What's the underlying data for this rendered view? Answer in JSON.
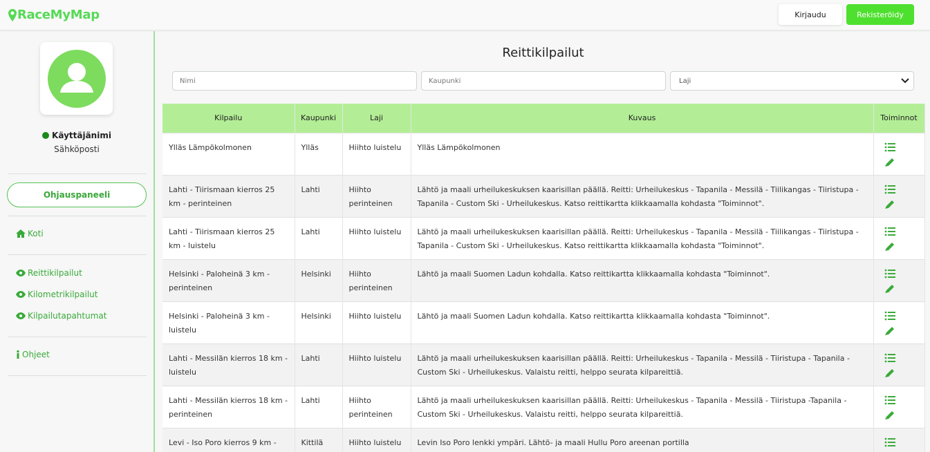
{
  "brand": {
    "name": "RaceMyMap",
    "accent": "#57d957"
  },
  "header": {
    "login_label": "Kirjaudu",
    "register_label": "Rekisteröidy"
  },
  "sidebar": {
    "username": "Käyttäjänimi",
    "email": "Sähköposti",
    "panel_label": "Ohjauspaneeli",
    "home_label": "Koti",
    "items": [
      {
        "label": "Reittikilpailut",
        "icon": "eye-icon"
      },
      {
        "label": "Kilometrikilpailut",
        "icon": "eye-icon"
      },
      {
        "label": "Kilpailutapahtumat",
        "icon": "eye-icon"
      }
    ],
    "help_label": "Ohjeet"
  },
  "main": {
    "title": "Reittikilpailut",
    "filters": {
      "name_placeholder": "Nimi",
      "city_placeholder": "Kaupunki",
      "sport_selected": "Laji"
    },
    "columns": [
      "Kilpailu",
      "Kaupunki",
      "Laji",
      "Kuvaus",
      "Toiminnot"
    ],
    "rows": [
      {
        "race": "Ylläs Lämpökolmonen",
        "city": "Ylläs",
        "sport": "Hiihto luistelu",
        "desc": "Ylläs Lämpökolmonen"
      },
      {
        "race": "Lahti - Tiirismaan kierros 25 km - perinteinen",
        "city": "Lahti",
        "sport": "Hiihto perinteinen",
        "desc": "Lähtö ja maali urheilukeskuksen kaarisillan päällä. Reitti: Urheilukeskus - Tapanila - Messilä - Tiilikangas - Tiiristupa - Tapanila - Custom Ski - Urheilukeskus. Katso reittikartta klikkaamalla kohdasta \"Toiminnot\"."
      },
      {
        "race": "Lahti - Tiirismaan kierros 25 km - luistelu",
        "city": "Lahti",
        "sport": "Hiihto luistelu",
        "desc": "Lähtö ja maali urheilukeskuksen kaarisillan päällä. Reitti: Urheilukeskus - Tapanila - Messilä - Tiilikangas - Tiiristupa - Tapanila - Custom Ski - Urheilukeskus. Katso reittikartta klikkaamalla kohdasta \"Toiminnot\"."
      },
      {
        "race": "Helsinki - Paloheinä 3 km - perinteinen",
        "city": "Helsinki",
        "sport": "Hiihto perinteinen",
        "desc": "Lähtö ja maali Suomen Ladun kohdalla. Katso reittikartta klikkaamalla kohdasta \"Toiminnot\"."
      },
      {
        "race": "Helsinki - Paloheinä 3 km - luistelu",
        "city": "Helsinki",
        "sport": "Hiihto luistelu",
        "desc": "Lähtö ja maali Suomen Ladun kohdalla. Katso reittikartta klikkaamalla kohdasta \"Toiminnot\"."
      },
      {
        "race": "Lahti - Messilän kierros 18 km - luistelu",
        "city": "Lahti",
        "sport": "Hiihto luistelu",
        "desc": "Lähtö ja maali urheilukeskuksen kaarisillan päällä. Reitti: Urheilukeskus - Tapanila - Messilä - Tiiristupa - Tapanila - Custom Ski - Urheilukeskus. Valaistu reitti, helppo seurata kilpareittiä."
      },
      {
        "race": "Lahti - Messilän kierros 18 km - perinteinen",
        "city": "Lahti",
        "sport": "Hiihto perinteinen",
        "desc": "Lähtö ja maali urheilukeskuksen kaarisillan päällä. Reitti: Urheilukeskus - Tapanila - Messilä - Tiiristupa -Tapanila - Custom Ski - Urheilukeskus. Valaistu reitti, helppo seurata kilpareittiä."
      },
      {
        "race": "Levi - Iso Poro kierros 9 km -",
        "city": "Kittilä",
        "sport": "Hiihto luistelu",
        "desc": "Levin Iso Poro lenkki ympäri. Lähtö- ja maali Hullu Poro areenan portilla"
      }
    ]
  }
}
